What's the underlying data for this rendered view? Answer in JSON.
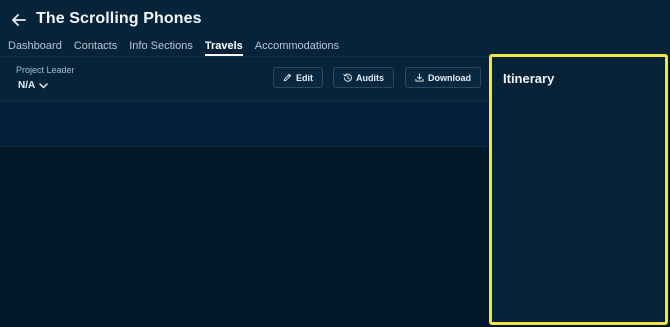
{
  "header": {
    "title": "The Scrolling Phones",
    "back_icon": "arrow-left-icon"
  },
  "tabs": [
    {
      "label": "Dashboard",
      "active": false
    },
    {
      "label": "Contacts",
      "active": false
    },
    {
      "label": "Info Sections",
      "active": false
    },
    {
      "label": "Travels",
      "active": true
    },
    {
      "label": "Accommodations",
      "active": false
    }
  ],
  "toolbar": {
    "project_leader_label": "Project Leader",
    "project_leader_value": "N/A",
    "edit_label": "Edit",
    "audits_label": "Audits",
    "download_label": "Download"
  },
  "itinerary": {
    "title": "Itinerary"
  },
  "colors": {
    "highlight": "#f2e443",
    "background": "#03192a",
    "panel": "#062237"
  }
}
